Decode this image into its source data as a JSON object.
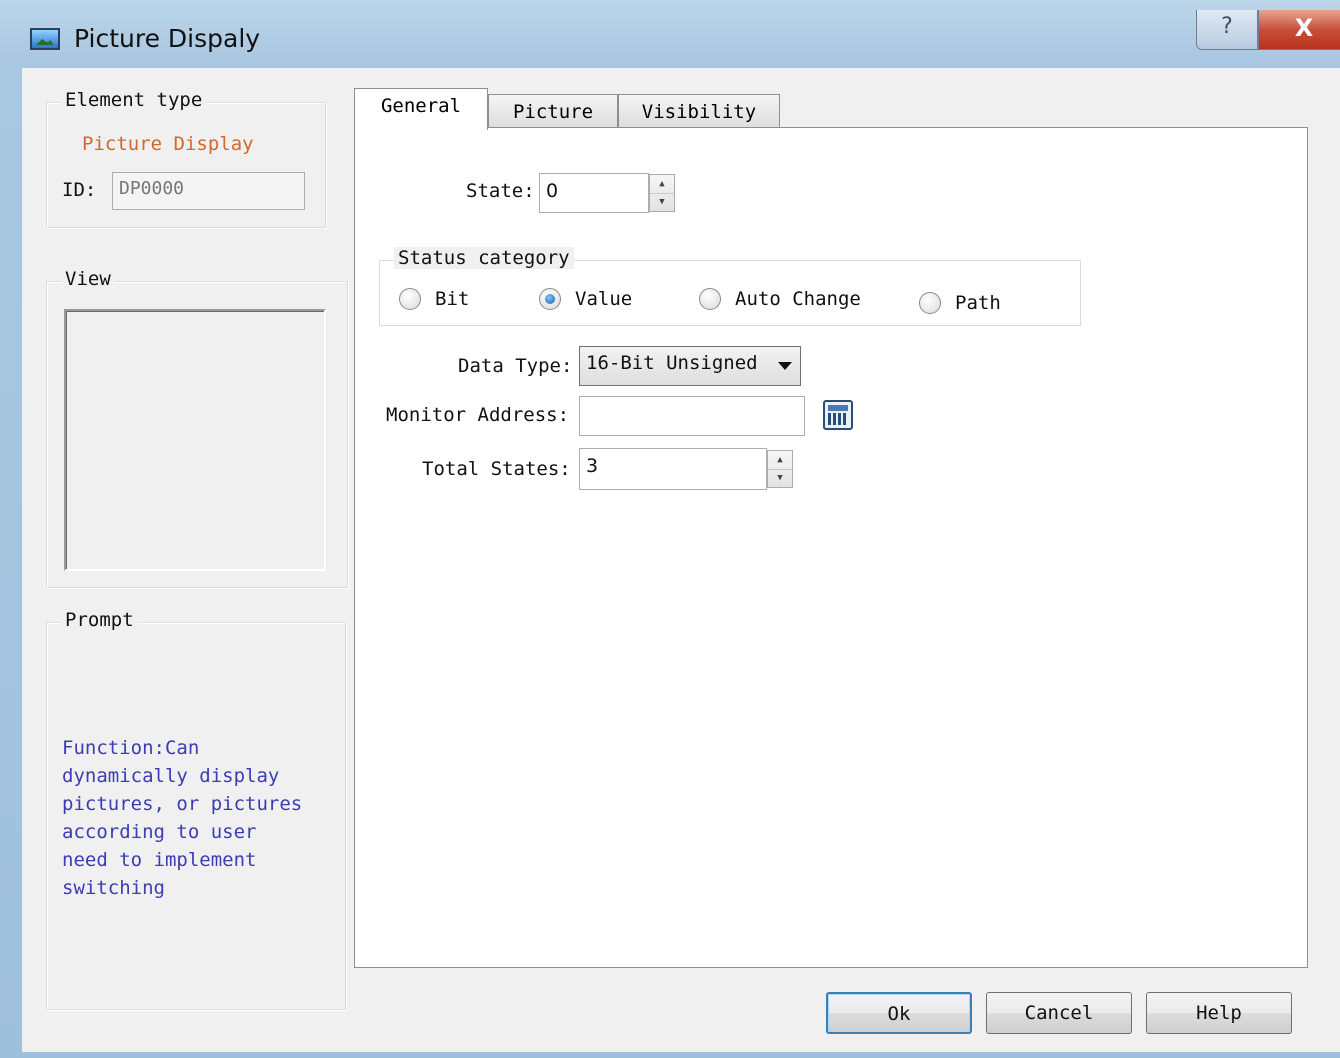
{
  "window": {
    "title": "Picture Dispaly",
    "help_glyph": "?",
    "close_glyph": "X"
  },
  "left_panel": {
    "element_type_label": "Element type",
    "element_type_value": "Picture Display",
    "id_label": "ID:",
    "id_value": "DP0000",
    "view_label": "View",
    "prompt_label": "Prompt",
    "prompt_text": "Function:Can\ndynamically display\npictures, or pictures\naccording to user\nneed to implement\nswitching"
  },
  "tabs": [
    {
      "label": "General",
      "active": true
    },
    {
      "label": "Picture",
      "active": false
    },
    {
      "label": "Visibility",
      "active": false
    }
  ],
  "general": {
    "state_label": "State:",
    "state_value": "0",
    "status_category_label": "Status category",
    "status_options": [
      {
        "label": "Bit",
        "checked": false
      },
      {
        "label": "Value",
        "checked": true
      },
      {
        "label": "Auto Change",
        "checked": false
      },
      {
        "label": "Path",
        "checked": false
      }
    ],
    "data_type_label": "Data Type:",
    "data_type_value": "16-Bit Unsigned",
    "monitor_address_label": "Monitor Address:",
    "monitor_address_value": "",
    "total_states_label": "Total States:",
    "total_states_value": "3"
  },
  "buttons": {
    "ok": "Ok",
    "cancel": "Cancel",
    "help": "Help"
  },
  "icons": {
    "app": "picture-icon",
    "calculator": "calculator-icon",
    "spin_up": "▲",
    "spin_down": "▼"
  }
}
